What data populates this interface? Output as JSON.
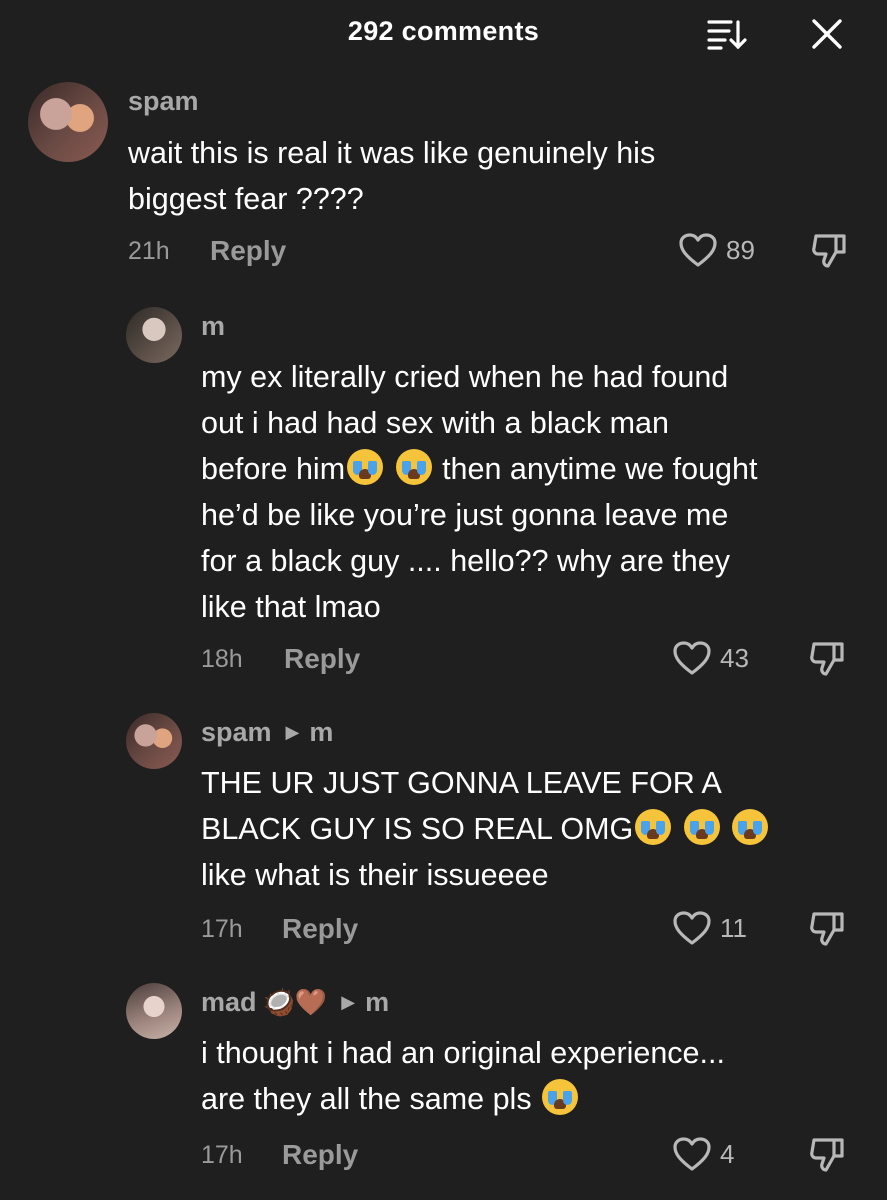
{
  "header": {
    "title": "292 comments"
  },
  "comments": [
    {
      "username": "spam",
      "text": "wait this is real it was like genuinely his\nbiggest fear ????",
      "time": "21h",
      "reply_label": "Reply",
      "likes": "89"
    },
    {
      "username": "m",
      "text_lines": [
        "my ex literally cried when he had found",
        "out i had had sex with a black man",
        "before him",
        " then anytime we fought",
        "he’d be like you’re just gonna leave me",
        "for a black guy .... hello?? why are they",
        "like that lmao"
      ],
      "time": "18h",
      "reply_label": "Reply",
      "likes": "43"
    },
    {
      "username": "spam",
      "reply_to": "m",
      "text_lines": [
        "THE UR JUST GONNA LEAVE FOR A",
        "BLACK GUY IS SO REAL OMG",
        "like what is their issueeee"
      ],
      "time": "17h",
      "reply_label": "Reply",
      "likes": "11"
    },
    {
      "username": "mad",
      "username_emoji": "🥥🤎",
      "reply_to": "m",
      "text_lines": [
        "i thought i had an original experience...",
        "are they all the same pls"
      ],
      "time": "17h",
      "reply_label": "Reply",
      "likes": "4"
    }
  ],
  "icons": {
    "sort": "sort-icon",
    "close": "close-icon",
    "like": "heart-outline-icon",
    "dislike": "thumbs-down-icon",
    "emoji": "loudly-crying-face-emoji"
  }
}
